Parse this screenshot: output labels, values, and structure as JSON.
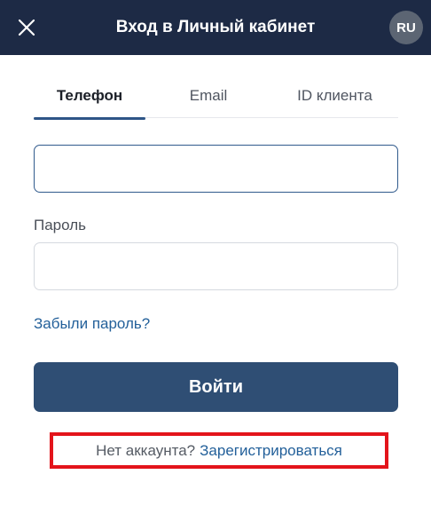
{
  "header": {
    "title": "Вход в Личный кабинет",
    "language": "RU",
    "close_icon": "close-icon"
  },
  "tabs": [
    {
      "label": "Телефон",
      "active": true
    },
    {
      "label": "Email",
      "active": false
    },
    {
      "label": "ID клиента",
      "active": false
    }
  ],
  "form": {
    "phone_value": "",
    "password_label": "Пароль",
    "password_value": "",
    "forgot_password": "Забыли пароль?",
    "login_button": "Войти"
  },
  "footer": {
    "no_account_text": "Нет аккаунта?",
    "register_link": "Зарегистрироваться",
    "highlight_color": "#e3141b"
  },
  "colors": {
    "header_bg": "#1d2a45",
    "accent": "#2e5587",
    "button_bg": "#2f4e74",
    "link": "#23609a"
  }
}
